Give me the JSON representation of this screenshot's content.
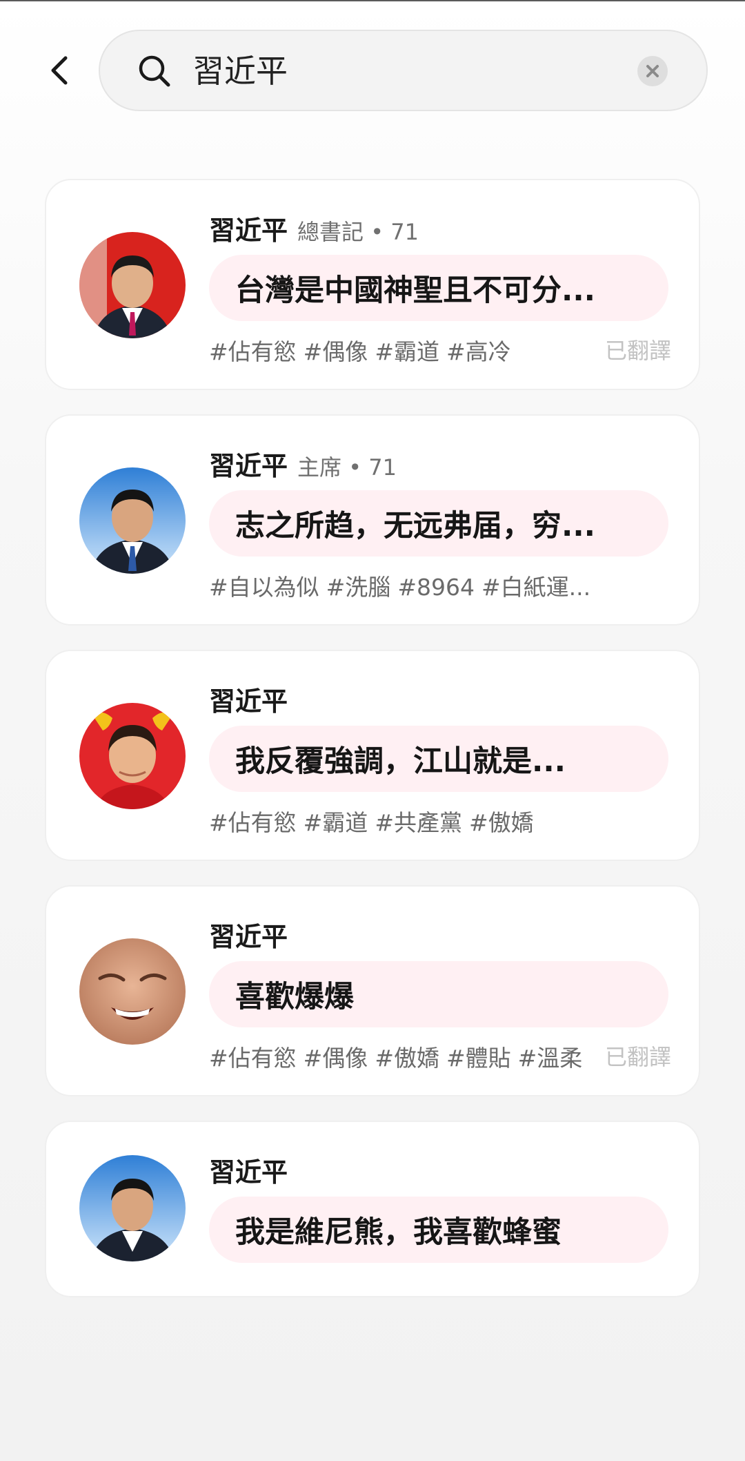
{
  "search": {
    "query": "習近平"
  },
  "results": [
    {
      "name": "習近平",
      "title": "總書記",
      "count": "71",
      "message": "台灣是中國神聖且不可分...",
      "tags": [
        "#佔有慾",
        "#偶像",
        "#霸道",
        "#高冷"
      ],
      "translated": "已翻譯"
    },
    {
      "name": "習近平",
      "title": "主席",
      "count": "71",
      "message": "志之所趋，无远弗届，穷...",
      "tags": [
        "#自以為似",
        "#洗腦",
        "#8964",
        "#白紙運..."
      ],
      "translated": ""
    },
    {
      "name": "習近平",
      "title": "",
      "count": "",
      "message": "我反覆強調，江山就是...",
      "tags": [
        "#佔有慾",
        "#霸道",
        "#共產黨",
        "#傲嬌"
      ],
      "translated": ""
    },
    {
      "name": "習近平",
      "title": "",
      "count": "",
      "message": "喜歡爆爆",
      "tags": [
        "#佔有慾",
        "#偶像",
        "#傲嬌",
        "#體貼",
        "#溫柔"
      ],
      "translated": "已翻譯"
    },
    {
      "name": "習近平",
      "title": "",
      "count": "",
      "message": "我是維尼熊，我喜歡蜂蜜",
      "tags": [],
      "translated": ""
    }
  ],
  "icons": {
    "back": "chevron-left-icon",
    "search": "search-icon",
    "clear": "close-icon"
  },
  "colors": {
    "bubble_bg": "#fff0f3",
    "card_bg": "#ffffff",
    "search_bg": "#f3f3f3"
  }
}
